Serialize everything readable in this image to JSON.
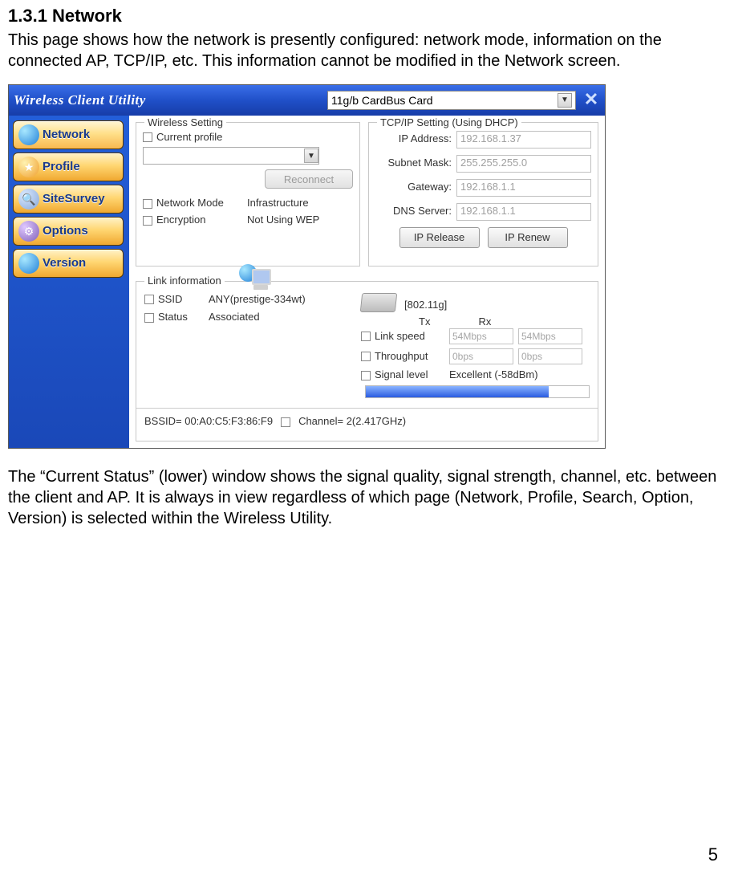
{
  "doc": {
    "heading": "1.3.1 Network",
    "para1": "This page shows how the network is presently configured: network mode, information on the connected AP, TCP/IP, etc. This information cannot be modified in the Network screen.",
    "para2": "The “Current Status” (lower) window shows the signal quality, signal strength, channel, etc. between the client and AP. It is always in view regardless of which page (Network, Profile, Search, Option, Version) is selected within the Wireless Utility.",
    "page_num": "5"
  },
  "app": {
    "title": "Wireless Client Utility",
    "card_selector": "11g/b CardBus Card",
    "nav": [
      {
        "label": "Network"
      },
      {
        "label": "Profile"
      },
      {
        "label": "SiteSurvey"
      },
      {
        "label": "Options"
      },
      {
        "label": "Version"
      }
    ]
  },
  "wireless": {
    "group_label": "Wireless Setting",
    "current_profile_label": "Current profile",
    "reconnect_label": "Reconnect",
    "network_mode_label": "Network Mode",
    "network_mode_value": "Infrastructure",
    "encryption_label": "Encryption",
    "encryption_value": "Not Using WEP"
  },
  "tcpip": {
    "group_label": "TCP/IP Setting   (Using DHCP)",
    "ip_label": "IP Address:",
    "ip_value": "192.168.1.37",
    "subnet_label": "Subnet Mask:",
    "subnet_value": "255.255.255.0",
    "gateway_label": "Gateway:",
    "gateway_value": "192.168.1.1",
    "dns_label": "DNS Server:",
    "dns_value": "192.168.1.1",
    "ip_release": "IP Release",
    "ip_renew": "IP Renew"
  },
  "link": {
    "group_label": "Link information",
    "ssid_label": "SSID",
    "ssid_value": "ANY(prestige-334wt)",
    "status_label": "Status",
    "status_value": "Associated",
    "mode_tag": "[802.11g]",
    "tx_label": "Tx",
    "rx_label": "Rx",
    "linkspeed_label": "Link speed",
    "linkspeed_tx": "54Mbps",
    "linkspeed_rx": "54Mbps",
    "throughput_label": "Throughput",
    "throughput_tx": "0bps",
    "throughput_rx": "0bps",
    "signal_label": "Signal level",
    "signal_value": "Excellent (-58dBm)",
    "bssid_line": "BSSID= 00:A0:C5:F3:86:F9",
    "channel_line": "Channel= 2(2.417GHz)"
  }
}
